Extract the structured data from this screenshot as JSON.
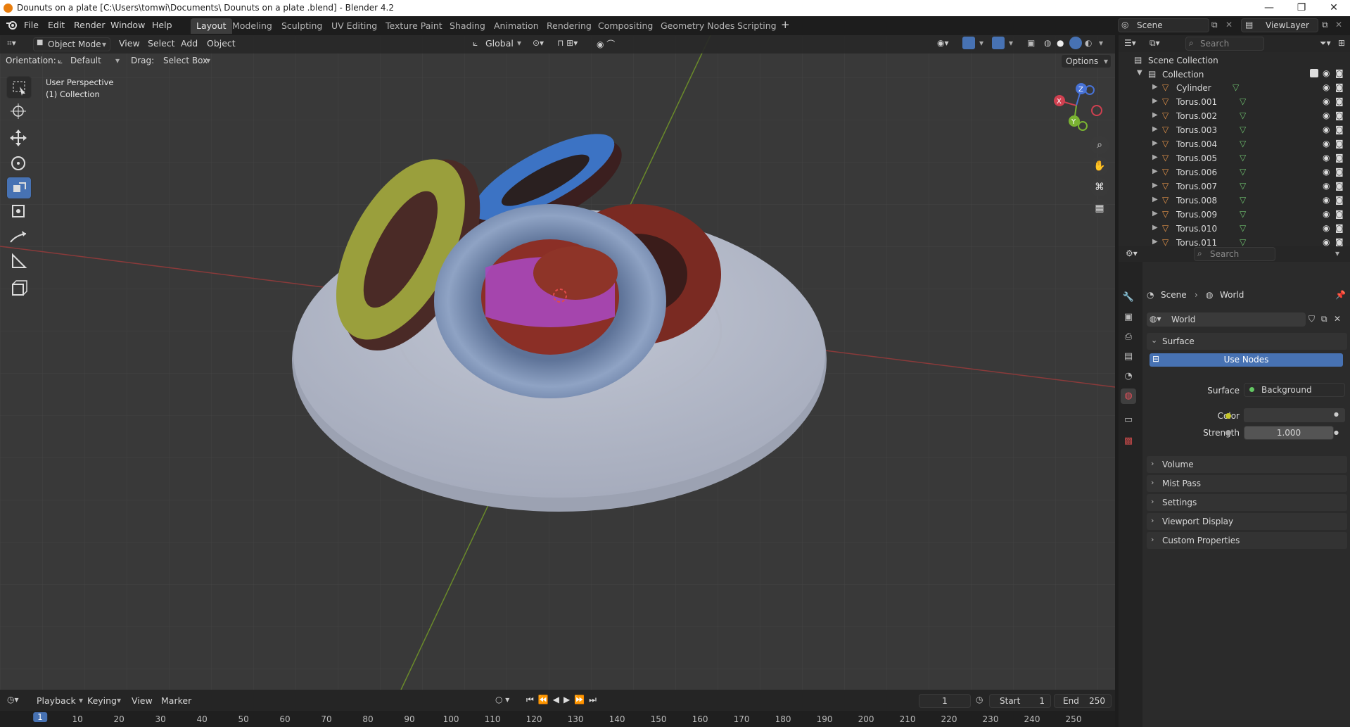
{
  "window": {
    "title": "Dounuts on a plate  [C:\\Users\\tomwi\\Documents\\ Dounuts on a plate .blend] - Blender 4.2",
    "minimize": "—",
    "maximize": "❐",
    "close": "✕"
  },
  "menu": [
    "File",
    "Edit",
    "Render",
    "Window",
    "Help"
  ],
  "workspaces": [
    {
      "label": "Layout",
      "active": true
    },
    {
      "label": "Modeling"
    },
    {
      "label": "Sculpting"
    },
    {
      "label": "UV Editing"
    },
    {
      "label": "Texture Paint"
    },
    {
      "label": "Shading"
    },
    {
      "label": "Animation"
    },
    {
      "label": "Rendering"
    },
    {
      "label": "Compositing"
    },
    {
      "label": "Geometry Nodes"
    },
    {
      "label": "Scripting"
    }
  ],
  "add_workspace": "+",
  "scene": {
    "label": "Scene",
    "view_layer": "ViewLayer"
  },
  "viewport_header": {
    "mode": "Object Mode",
    "menus": [
      "View",
      "Select",
      "Add",
      "Object"
    ],
    "transform": "Global",
    "options": "Options"
  },
  "orientation": {
    "label": "Orientation:",
    "value": "Default",
    "drag_label": "Drag:",
    "drag_value": "Select Box"
  },
  "viewport_overlay": {
    "line1": "User Perspective",
    "line2": "(1) Collection"
  },
  "gizmo": {
    "x": "X",
    "y": "Y",
    "z": "Z"
  },
  "timeline": {
    "menus": [
      "Playback",
      "Keying",
      "View",
      "Marker"
    ],
    "current_frame": "1",
    "start_label": "Start",
    "start": "1",
    "end_label": "End",
    "end": "250",
    "ticks": [
      "1",
      "10",
      "20",
      "30",
      "40",
      "50",
      "60",
      "70",
      "80",
      "90",
      "100",
      "110",
      "120",
      "130",
      "140",
      "150",
      "160",
      "170",
      "180",
      "190",
      "200",
      "210",
      "220",
      "230",
      "240",
      "250"
    ]
  },
  "outliner": {
    "search_placeholder": "Search",
    "scene_collection": "Scene Collection",
    "collection": "Collection",
    "items": [
      "Cylinder",
      "Torus.001",
      "Torus.002",
      "Torus.003",
      "Torus.004",
      "Torus.005",
      "Torus.006",
      "Torus.007",
      "Torus.008",
      "Torus.009",
      "Torus.010",
      "Torus.011"
    ]
  },
  "properties": {
    "search_placeholder": "Search",
    "breadcrumb_scene": "Scene",
    "breadcrumb_world": "World",
    "world_name": "World",
    "surface_header": "Surface",
    "use_nodes": "Use Nodes",
    "surface_label": "Surface",
    "surface_value": "Background",
    "color_label": "Color",
    "strength_label": "Strength",
    "strength_value": "1.000",
    "sections": [
      "Volume",
      "Mist Pass",
      "Settings",
      "Viewport Display",
      "Custom Properties"
    ]
  },
  "colors": {
    "accent": "#4772b3",
    "panel": "#2b2b2b",
    "viewport": "#393939",
    "object_orange": "#e8964a",
    "mesh_green": "#6fc26f"
  }
}
